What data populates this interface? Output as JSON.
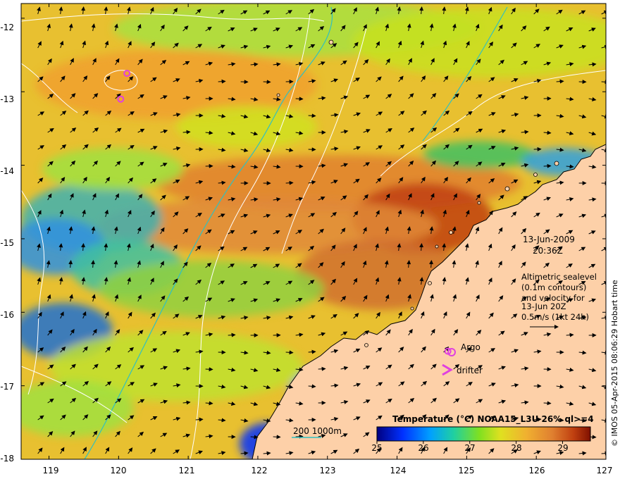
{
  "map": {
    "date": "13-Jun-2009",
    "time": "20:36Z",
    "info_lines": [
      "Altimetric sealevel",
      "(0.1m contours)",
      "and velocity for",
      "13-Jun 20Z",
      "0.5m/s (1kt 24h)"
    ],
    "lat_labels": [
      "-12",
      "-13",
      "-14",
      "-15",
      "-16",
      "-17",
      "-18"
    ],
    "lon_labels": [
      "119",
      "120",
      "121",
      "122",
      "123",
      "124",
      "125",
      "126",
      "127"
    ],
    "legend_argo": "Argo",
    "legend_drifter": "drifter",
    "depth_legend": "200  1000m",
    "credit": "© IMOS 05-Apr-2015 08:06:29 Hobart time",
    "colorbar": {
      "title": "Temperature (°C) NOAA15_L3U 26% ql>=4",
      "ticks": [
        "25",
        "26",
        "27",
        "28",
        "29"
      ],
      "range": [
        25,
        29.6
      ]
    },
    "colors": {
      "land": "#fdd0a8",
      "argo": "#e040e0",
      "depth_contour": "#30c0c0"
    },
    "argo_floats": [
      {
        "lon": 120.12,
        "lat": -12.75
      },
      {
        "lon": 120.03,
        "lat": -13.1
      },
      {
        "lon": 124.73,
        "lat": -16.53
      }
    ]
  }
}
